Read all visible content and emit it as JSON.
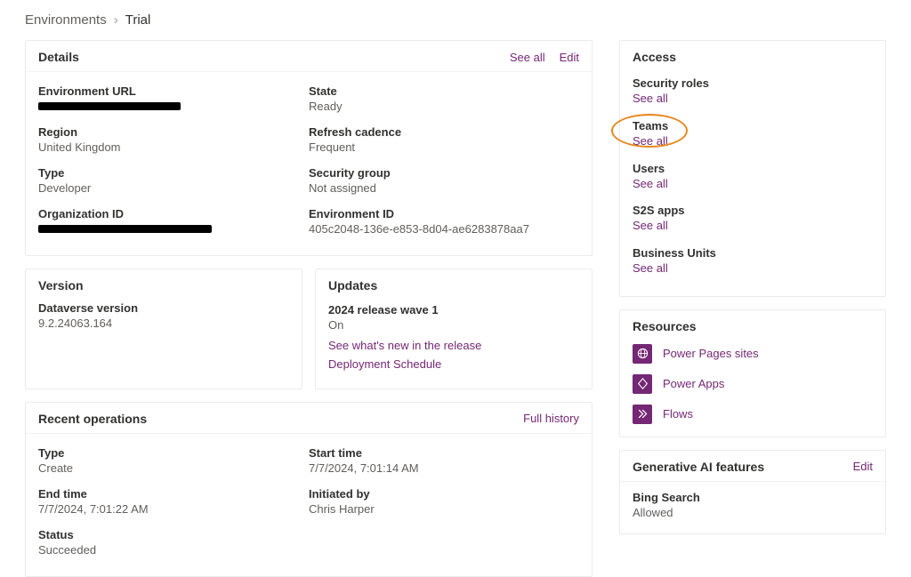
{
  "breadcrumb": {
    "root": "Environments",
    "current": "Trial"
  },
  "details": {
    "title": "Details",
    "see_all": "See all",
    "edit": "Edit",
    "fields": {
      "env_url_label": "Environment URL",
      "state_label": "State",
      "state_val": "Ready",
      "region_label": "Region",
      "region_val": "United Kingdom",
      "refresh_label": "Refresh cadence",
      "refresh_val": "Frequent",
      "type_label": "Type",
      "type_val": "Developer",
      "secgroup_label": "Security group",
      "secgroup_val": "Not assigned",
      "orgid_label": "Organization ID",
      "envid_label": "Environment ID",
      "envid_val": "405c2048-136e-e853-8d04-ae6283878aa7"
    }
  },
  "version": {
    "title": "Version",
    "dv_label": "Dataverse version",
    "dv_val": "9.2.24063.164"
  },
  "updates": {
    "title": "Updates",
    "wave_label": "2024 release wave 1",
    "wave_val": "On",
    "link1": "See what's new in the release",
    "link2": "Deployment Schedule"
  },
  "recent": {
    "title": "Recent operations",
    "full_history": "Full history",
    "type_label": "Type",
    "type_val": "Create",
    "start_label": "Start time",
    "start_val": "7/7/2024, 7:01:14 AM",
    "end_label": "End time",
    "end_val": "7/7/2024, 7:01:22 AM",
    "init_label": "Initiated by",
    "init_val": "Chris Harper",
    "status_label": "Status",
    "status_val": "Succeeded"
  },
  "access": {
    "title": "Access",
    "see_all": "See all",
    "items": [
      {
        "label": "Security roles"
      },
      {
        "label": "Teams"
      },
      {
        "label": "Users"
      },
      {
        "label": "S2S apps"
      },
      {
        "label": "Business Units"
      }
    ]
  },
  "resources": {
    "title": "Resources",
    "items": [
      {
        "label": "Power Pages sites"
      },
      {
        "label": "Power Apps"
      },
      {
        "label": "Flows"
      }
    ]
  },
  "genai": {
    "title": "Generative AI features",
    "edit": "Edit",
    "bing_label": "Bing Search",
    "bing_val": "Allowed"
  }
}
